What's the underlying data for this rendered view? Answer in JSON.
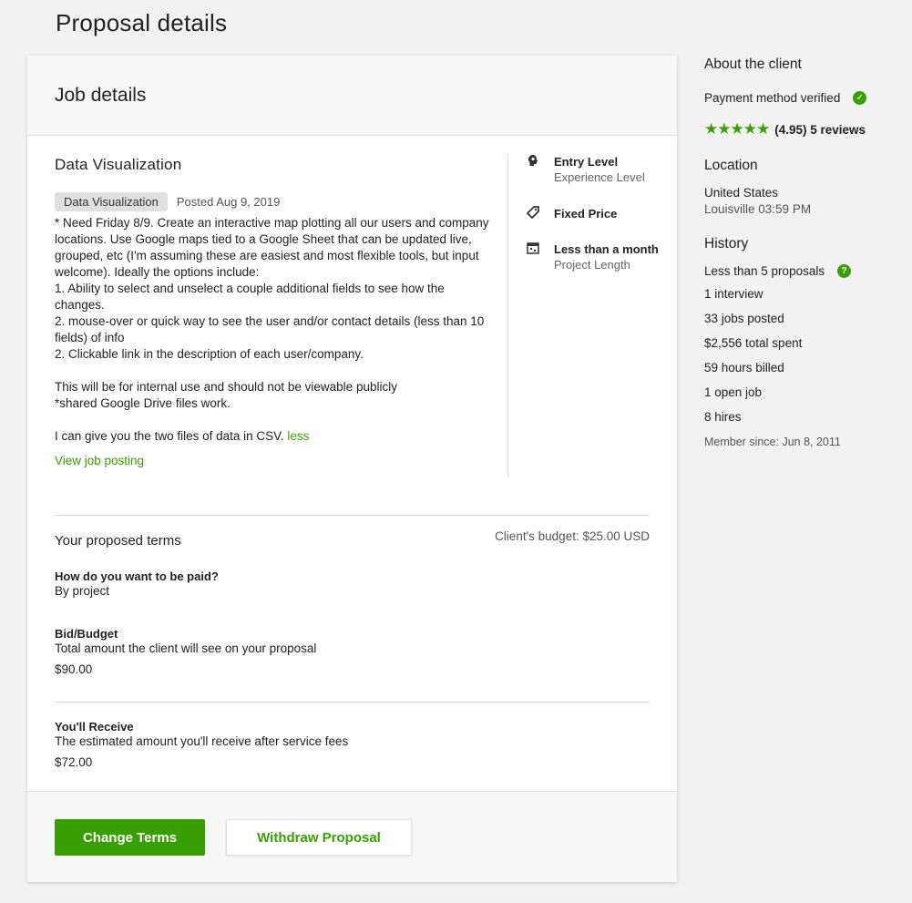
{
  "page": {
    "title": "Proposal details"
  },
  "job": {
    "header": "Job details",
    "title": "Data Visualization",
    "tag": "Data Visualization",
    "posted": "Posted Aug 9, 2019",
    "description": "* Need Friday 8/9. Create an interactive map plotting all our users and company locations. Use Google maps tied to a Google Sheet that can be updated live, grouped, etc (I'm assuming these are easiest and most flexible tools, but input welcome). Ideally the options include:\n1. Ability to select and unselect a couple additional fields to see how the changes.\n2. mouse-over or quick way to see the user and/or contact details (less than 10 fields) of info\n2. Clickable link in the description of each user/company.\n\nThis will be for internal use and should not be viewable publicly\n*shared Google Drive files work.\n\nI can give you the two files of data in CSV.",
    "less_link": "less",
    "view_posting": "View job posting",
    "meta": {
      "level": {
        "title": "Entry Level",
        "sub": "Experience Level",
        "icon": "brain-head-icon"
      },
      "price": {
        "title": "Fixed Price",
        "icon": "price-tag-icon"
      },
      "length": {
        "title": "Less than a month",
        "sub": "Project Length",
        "icon": "calendar-icon"
      }
    }
  },
  "terms": {
    "title": "Your proposed terms",
    "budget": "Client's budget: $25.00 USD",
    "paid_label": "How do you want to be paid?",
    "paid_value": "By project",
    "bid_label": "Bid/Budget",
    "bid_desc": "Total amount the client will see on your proposal",
    "bid_value": "$90.00",
    "receive_label": "You'll Receive",
    "receive_desc": "The estimated amount you'll receive after service fees",
    "receive_value": "$72.00"
  },
  "actions": {
    "change": "Change Terms",
    "withdraw": "Withdraw Proposal"
  },
  "client": {
    "about": "About the client",
    "payment": "Payment method verified",
    "stars": "★★★★★",
    "rating": "(4.95) 5 reviews",
    "location_title": "Location",
    "country": "United States",
    "city_time": "Louisville 03:59 PM",
    "history_title": "History",
    "proposals": "Less than 5 proposals",
    "interviews": "1 interview",
    "jobs_posted": "33 jobs posted",
    "spent": "$2,556 total spent",
    "hours": "59 hours billed",
    "open_jobs": "1 open job",
    "hires": "8 hires",
    "member_since": "Member since: Jun 8, 2011"
  },
  "colors": {
    "accent": "#37a000",
    "background": "#f2f2f2"
  }
}
